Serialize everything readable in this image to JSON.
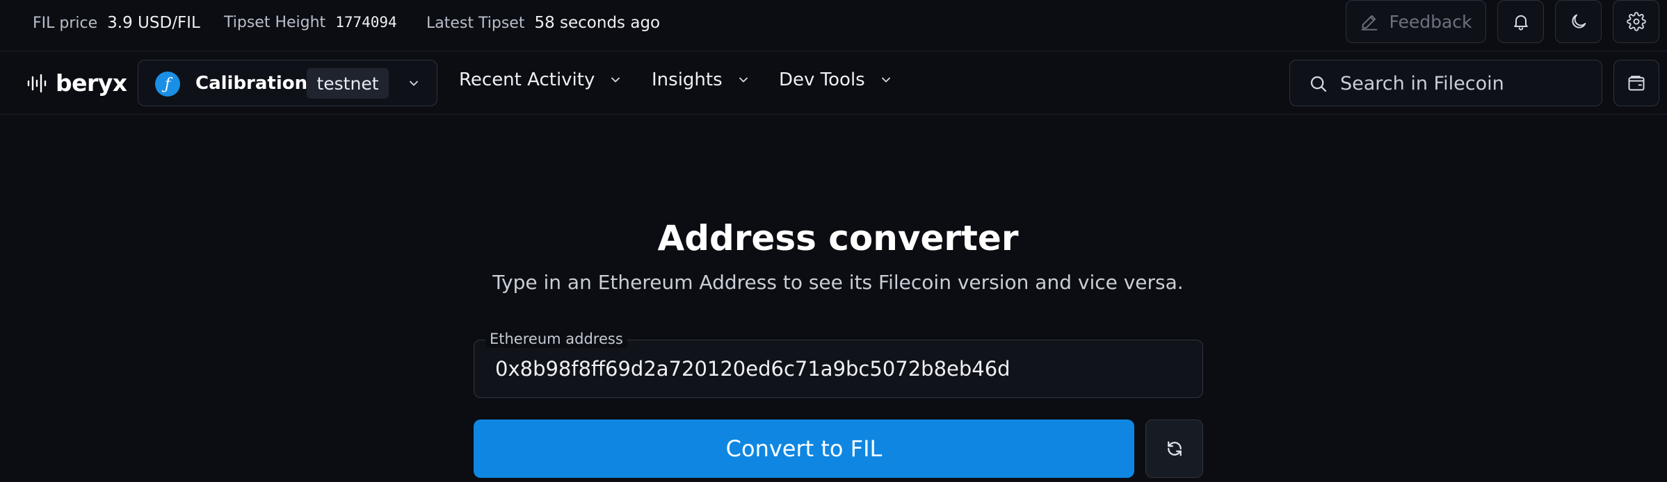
{
  "topbar": {
    "fil_price_label": "FIL price",
    "fil_price_value": "3.9 USD/FIL",
    "tipset_height_label": "Tipset Height",
    "tipset_height_value": "1774094",
    "latest_tipset_label": "Latest Tipset",
    "latest_tipset_value": "58 seconds ago",
    "feedback_label": "Feedback",
    "icons": [
      "pencil-icon",
      "bell-icon",
      "moon-icon",
      "gear-icon"
    ]
  },
  "nav": {
    "logo_text": "beryx",
    "network_name": "Calibration",
    "network_badge": "testnet",
    "menu": [
      {
        "label": "Recent Activity"
      },
      {
        "label": "Insights"
      },
      {
        "label": "Dev Tools"
      }
    ],
    "search_placeholder": "Search in Filecoin"
  },
  "converter": {
    "title": "Address converter",
    "subtitle": "Type in an Ethereum Address to see its Filecoin version and vice versa.",
    "field_label": "Ethereum address",
    "field_value": "0x8b98f8ff69d2a720120ed6c71a9bc5072b8eb46d",
    "convert_label": "Convert to FIL"
  },
  "colors": {
    "background": "#0b0d12",
    "accent": "#0f87e2",
    "border": "#2c3240"
  }
}
